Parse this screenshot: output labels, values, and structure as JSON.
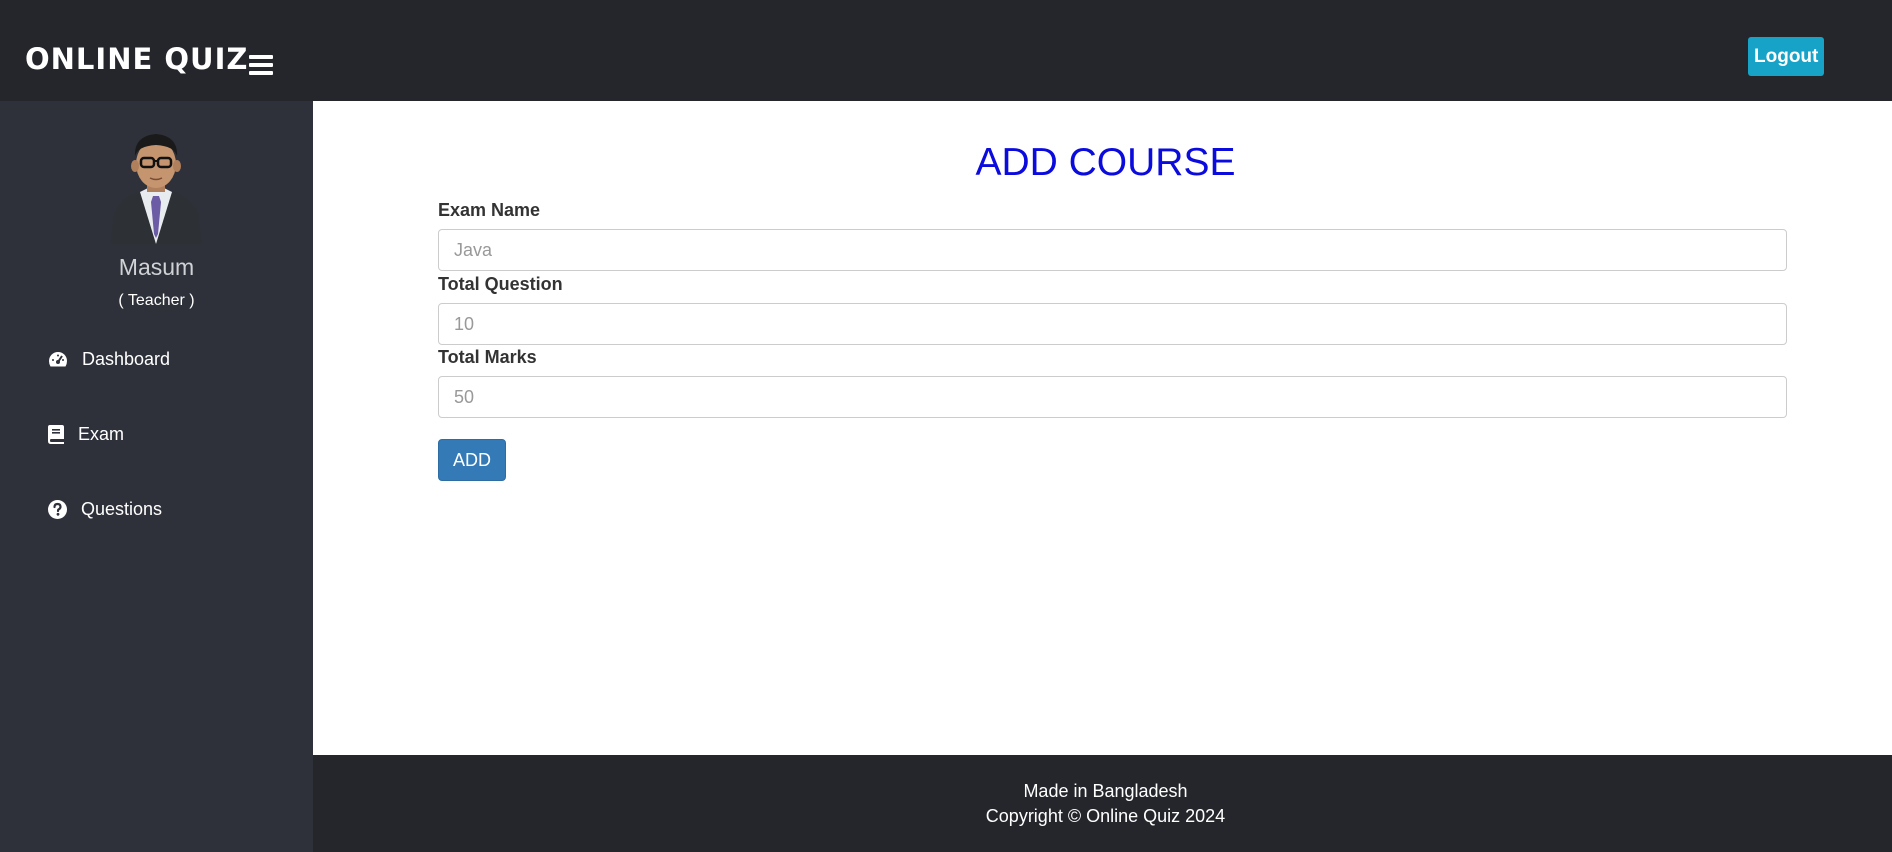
{
  "header": {
    "brand": "ONLINE QUIZ",
    "logout_label": "Logout"
  },
  "sidebar": {
    "user_name": "Masum",
    "user_role": "( Teacher )",
    "items": [
      {
        "label": "Dashboard",
        "icon": "tachometer-icon"
      },
      {
        "label": "Exam",
        "icon": "book-icon"
      },
      {
        "label": "Questions",
        "icon": "question-circle-icon"
      }
    ]
  },
  "main": {
    "title": "ADD COURSE",
    "fields": [
      {
        "label": "Exam Name",
        "placeholder": "Java"
      },
      {
        "label": "Total Question",
        "placeholder": "10"
      },
      {
        "label": "Total Marks",
        "placeholder": "50"
      }
    ],
    "submit_label": "ADD"
  },
  "footer": {
    "line1": "Made in Bangladesh",
    "line2": "Copyright © Online Quiz 2024"
  },
  "colors": {
    "header_bg": "#24262c",
    "sidebar_bg": "#2e313a",
    "title_color": "#0b0bde",
    "logout_bg": "#17a2c8",
    "add_button_bg": "#337ab7"
  }
}
